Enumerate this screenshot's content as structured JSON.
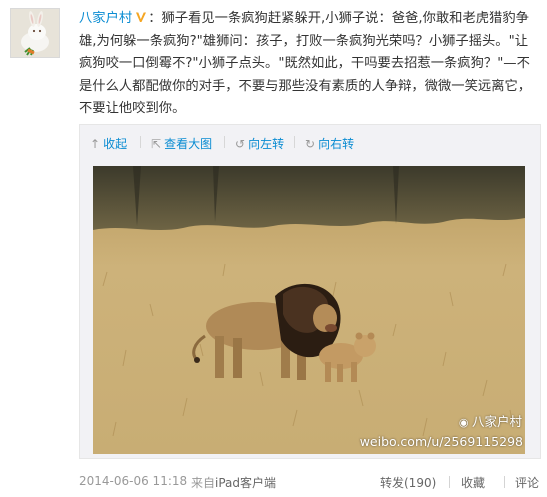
{
  "post": {
    "author": "八家户村",
    "verified_icon": "verified-v-badge",
    "colon": "：",
    "text": "狮子看见一条疯狗赶紧躲开,小狮子说：爸爸,你敢和老虎猎豹争雄,为何躲一条疯狗?\"雄狮问：孩子，打败一条疯狗光荣吗？小狮子摇头。\"让疯狗咬一口倒霉不?\"小狮子点头。\"既然如此，干吗要去招惹一条疯狗？\"—不是什么人都配做你的对手，不要与那些没有素质的人争辩，微微一笑远离它，不要让他咬到你。"
  },
  "media_toolbar": {
    "collapse": {
      "icon": "collapse-arrow-icon",
      "label": "收起"
    },
    "view_large": {
      "icon": "enlarge-icon",
      "label": "查看大图"
    },
    "rotate_left": {
      "icon": "rotate-left-icon",
      "label": "向左转"
    },
    "rotate_right": {
      "icon": "rotate-right-icon",
      "label": "向右转"
    }
  },
  "photo": {
    "subject": "lion and cub walking in savanna grass",
    "watermark_name": "八家户村",
    "watermark_url": "weibo.com/u/2569115298"
  },
  "footer": {
    "timestamp": "2014-06-06 11:18",
    "via_prefix": "来自",
    "via_client": "iPad客户端",
    "repost": "转发(190)",
    "favorite": "收藏",
    "comment": "评论"
  },
  "colors": {
    "link_blue": "#0a8cd2",
    "muted": "#999999",
    "media_bg": "#f2f2f5"
  }
}
